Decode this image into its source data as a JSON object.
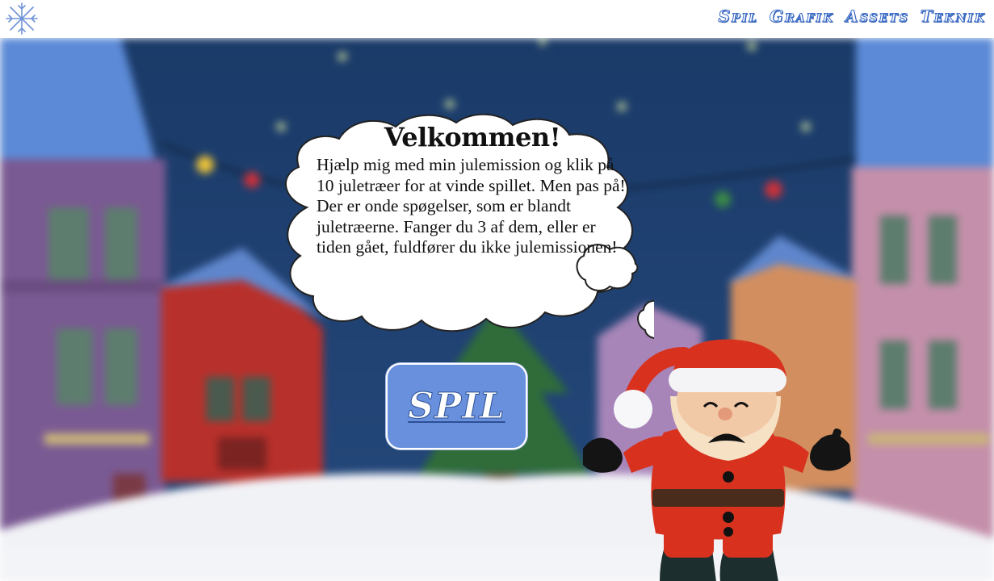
{
  "nav": {
    "logo_icon": "snowflake-icon",
    "items": [
      {
        "label": "Spil"
      },
      {
        "label": "Grafik"
      },
      {
        "label": "Assets"
      },
      {
        "label": "Teknik"
      }
    ]
  },
  "game": {
    "bubble_title": "Velkommen!",
    "bubble_text": "Hjælp mig med min julemission og klik på 10 juletræer for at vinde spillet. Men pas på! Der er onde spøgelser, som er blandt juletræerne. Fanger du 3 af dem, eller er tiden gået, fuldfører du ikke julemissionen!",
    "play_label": "SPIL"
  },
  "colors": {
    "nav_text": "#3f6fc9",
    "play_button": "#6890dc",
    "night_sky": "#1b3a6b",
    "snow": "#f3f4f7",
    "santa_red": "#d8321f"
  }
}
